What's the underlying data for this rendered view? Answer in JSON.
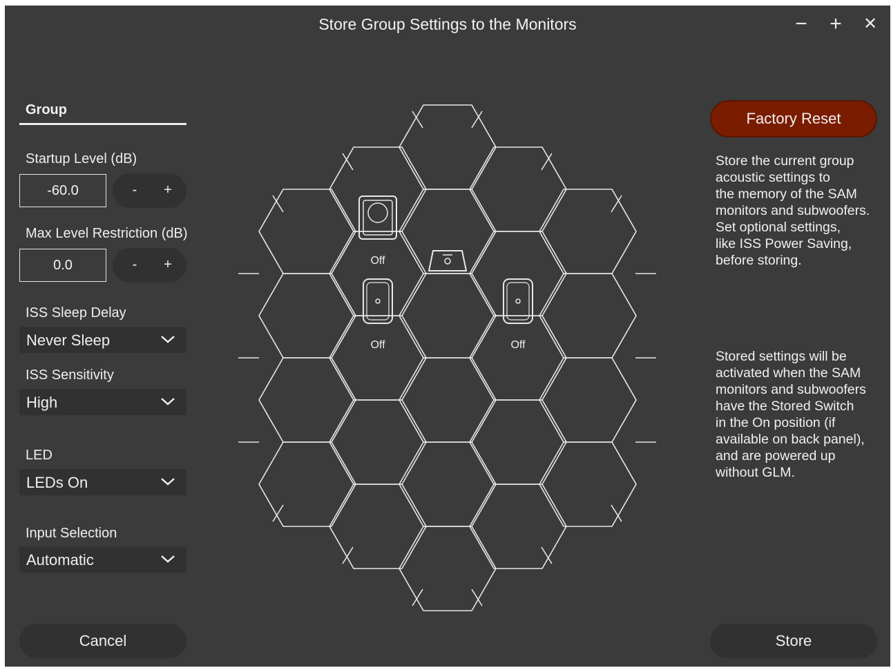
{
  "window": {
    "title": "Store Group Settings to the Monitors",
    "controls": {
      "minimize": "−",
      "maximize": "+",
      "close": "✕"
    }
  },
  "left_panel": {
    "tab_label": "Group",
    "startup_level": {
      "label": "Startup Level (dB)",
      "value": "-60.0",
      "minus": "-",
      "plus": "+"
    },
    "max_level": {
      "label": "Max Level Restriction (dB)",
      "value": "0.0",
      "minus": "-",
      "plus": "+"
    },
    "iss_sleep_delay": {
      "label": "ISS Sleep Delay",
      "value": "Never Sleep"
    },
    "iss_sensitivity": {
      "label": "ISS Sensitivity",
      "value": "High"
    },
    "led": {
      "label": "LED",
      "value": "LEDs On"
    },
    "input_selection": {
      "label": "Input Selection",
      "value": "Automatic"
    },
    "cancel_label": "Cancel"
  },
  "center": {
    "devices": [
      {
        "type": "monitor-large",
        "status": "Off"
      },
      {
        "type": "subwoofer",
        "status": ""
      },
      {
        "type": "monitor",
        "status": "Off"
      },
      {
        "type": "monitor",
        "status": "Off"
      }
    ]
  },
  "right_panel": {
    "factory_reset_label": "Factory Reset",
    "description_1": [
      "Store the current group",
      "acoustic settings to",
      "the memory of the SAM",
      "monitors and subwoofers.",
      "Set optional settings,",
      "like ISS Power Saving,",
      "before storing."
    ],
    "description_2": [
      "Stored settings will be",
      "activated when the SAM",
      "monitors and subwoofers",
      "have the Stored Switch",
      "in the On position (if",
      "available on back panel),",
      "and are powered up",
      "without GLM."
    ],
    "store_label": "Store"
  },
  "colors": {
    "window_bg": "#3b3b3b",
    "control_bg": "#313131",
    "accent_reset": "#7a1c00",
    "hex_line": "#e8e8e8"
  }
}
